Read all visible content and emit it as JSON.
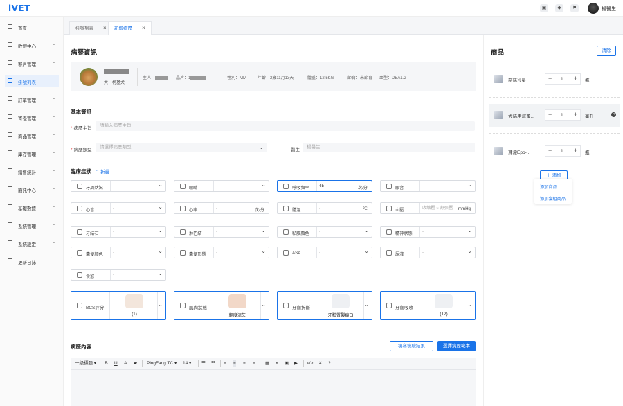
{
  "app": {
    "logo": "iVET",
    "user_name": "楊醫生"
  },
  "topbar_icons": [
    "picture-icon",
    "lock-icon",
    "flag-icon"
  ],
  "sidebar": {
    "items": [
      {
        "label": "首頁",
        "icon": "home-icon",
        "chevron": false,
        "active": false
      },
      {
        "label": "收銀中心",
        "icon": "cashier-icon",
        "chevron": true,
        "active": false
      },
      {
        "label": "客戶管理",
        "icon": "customer-icon",
        "chevron": true,
        "active": false
      },
      {
        "label": "掛號列表",
        "icon": "register-icon",
        "chevron": false,
        "active": true
      },
      {
        "label": "訂單管理",
        "icon": "order-icon",
        "chevron": true,
        "active": false
      },
      {
        "label": "寄養管理",
        "icon": "boarding-icon",
        "chevron": true,
        "active": false
      },
      {
        "label": "商品管理",
        "icon": "product-icon",
        "chevron": true,
        "active": false
      },
      {
        "label": "庫存管理",
        "icon": "inventory-icon",
        "chevron": true,
        "active": false
      },
      {
        "label": "銷售統計",
        "icon": "stats-icon",
        "chevron": true,
        "active": false
      },
      {
        "label": "簡訊中心",
        "icon": "sms-icon",
        "chevron": true,
        "active": false
      },
      {
        "label": "基礎數據",
        "icon": "database-icon",
        "chevron": true,
        "active": false
      },
      {
        "label": "系統管理",
        "icon": "system-icon",
        "chevron": true,
        "active": false
      },
      {
        "label": "系統設定",
        "icon": "settings-icon",
        "chevron": true,
        "active": false
      },
      {
        "label": "更新日誌",
        "icon": "log-icon",
        "chevron": false,
        "active": false
      }
    ]
  },
  "tabs": [
    {
      "label": "掛號列表",
      "active": false
    },
    {
      "label": "新增病歷",
      "active": true
    }
  ],
  "main": {
    "title": "病歷資訊",
    "pet": {
      "sub": "犬　柯基犬",
      "owner_label": "主人：",
      "chip_label": "晶片：1",
      "gender_label": "性別：MM",
      "age_label": "年齡：2歲11月13天",
      "weight_label": "體重：12.5KG",
      "neuter_label": "節育：未節育",
      "blood_label": "血型：DEA1.2"
    },
    "basic_title": "基本資訊",
    "chief_label": "病歷主旨",
    "chief_placeholder": "請輸入病歷主旨",
    "type_label": "病歷類型",
    "type_placeholder": "請選擇病歷類型",
    "doctor_label": "醫生",
    "doctor_placeholder": "楊醫生",
    "clinical_title": "臨床症狀",
    "collapse_label": "折疊",
    "symptoms": [
      {
        "label": "牙周狀況",
        "value": "-",
        "unit": "",
        "kind": "select",
        "highlight": false
      },
      {
        "label": "眼睛",
        "value": "-",
        "unit": "",
        "kind": "select",
        "highlight": false
      },
      {
        "label": "呼吸頻率",
        "value": "45",
        "unit": "次/分",
        "kind": "unit",
        "highlight": true
      },
      {
        "label": "願音",
        "value": "-",
        "unit": "",
        "kind": "select",
        "highlight": false
      },
      {
        "label": "心音",
        "value": "-",
        "unit": "",
        "kind": "select",
        "highlight": false
      },
      {
        "label": "心率",
        "value": "-",
        "unit": "次/分",
        "kind": "unit",
        "highlight": false
      },
      {
        "label": "體溫",
        "value": "-",
        "unit": "℃",
        "kind": "unit",
        "highlight": false
      },
      {
        "label": "血壓",
        "value": "收縮壓 ~ 舒張壓",
        "unit": "mmHg",
        "kind": "unit",
        "highlight": false
      },
      {
        "label": "牙結石",
        "value": "-",
        "unit": "",
        "kind": "select",
        "highlight": false
      },
      {
        "label": "淋巴結",
        "value": "-",
        "unit": "",
        "kind": "select",
        "highlight": false
      },
      {
        "label": "粘膜顏色",
        "value": "-",
        "unit": "",
        "kind": "select",
        "highlight": false
      },
      {
        "label": "精神狀態",
        "value": "-",
        "unit": "",
        "kind": "select",
        "highlight": false
      },
      {
        "label": "糞便顏色",
        "value": "-",
        "unit": "",
        "kind": "select",
        "highlight": false
      },
      {
        "label": "糞便形態",
        "value": "-",
        "unit": "",
        "kind": "select",
        "highlight": false
      },
      {
        "label": "ASA",
        "value": "-",
        "unit": "",
        "kind": "select",
        "highlight": false
      },
      {
        "label": "尿液",
        "value": "-",
        "unit": "",
        "kind": "select",
        "highlight": false
      },
      {
        "label": "食慾",
        "value": "-",
        "unit": "",
        "kind": "select",
        "highlight": false
      }
    ],
    "image_symptoms": [
      {
        "label": "BCS評分",
        "caption": "(1)"
      },
      {
        "label": "肌肉狀態",
        "caption": "輕度流失"
      },
      {
        "label": "牙齒折斷",
        "caption": "牙釉質裂痕EI"
      },
      {
        "label": "牙齒吸收",
        "caption": "(T2)"
      }
    ],
    "content_title": "病歷內容",
    "fill_result_label": "填寫檢驗結果",
    "select_template_label": "選擇病歷範本",
    "editor": {
      "heading": "一級標題",
      "font": "PingFang TC",
      "size": "14"
    }
  },
  "products": {
    "title": "商品",
    "clear_label": "清除",
    "items": [
      {
        "name": "惡諾沙星",
        "qty": "1",
        "unit": "瓶",
        "highlight": false
      },
      {
        "name": "犬貓用減蚤...",
        "qty": "1",
        "unit": "毫升",
        "highlight": true
      },
      {
        "name": "耳漂Epo-...",
        "qty": "1",
        "unit": "瓶",
        "highlight": false
      }
    ],
    "add_label": "添加",
    "dropdown": [
      "添加商品",
      "添加套組商品"
    ]
  }
}
